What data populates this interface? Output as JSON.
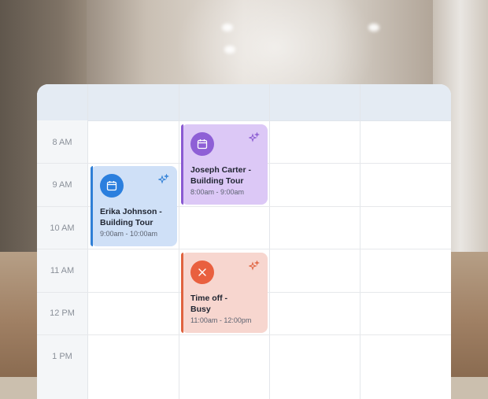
{
  "time_labels": [
    "8 AM",
    "9 AM",
    "10 AM",
    "11 AM",
    "12 PM",
    "1 PM"
  ],
  "events": [
    {
      "title_line1": "Joseph Carter -",
      "title_line2": "Building Tour",
      "time": "8:00am - 9:00am",
      "icon": "calendar-icon",
      "color": "#8e5fd6"
    },
    {
      "title_line1": "Erika Johnson -",
      "title_line2": "Building Tour",
      "time": "9:00am - 10:00am",
      "icon": "calendar-icon",
      "color": "#2b7fde"
    },
    {
      "title_line1": "Time off -",
      "title_line2": "Busy",
      "time": "11:00am - 12:00pm",
      "icon": "close-icon",
      "color": "#e9603f"
    }
  ]
}
